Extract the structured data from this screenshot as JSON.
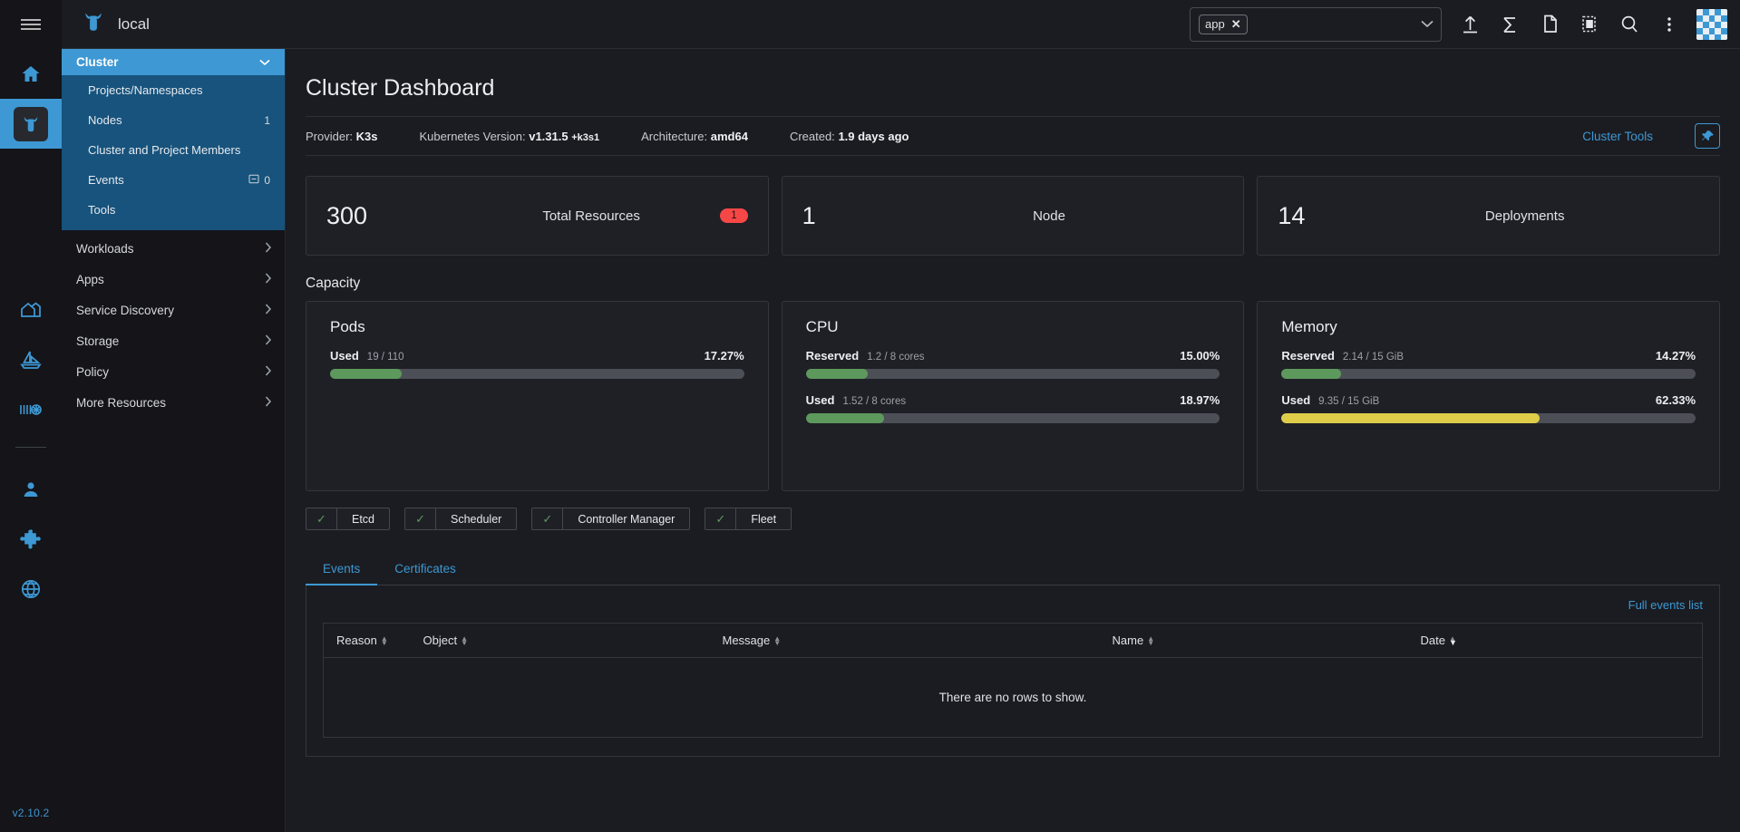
{
  "rail": {
    "hamburger": "menu-icon",
    "items": [
      {
        "icon": "home-icon",
        "name": "home",
        "active": false
      },
      {
        "icon": "cluster-icon",
        "name": "cluster-local",
        "active": true
      },
      {
        "icon": "barn-icon",
        "name": "cluster-management",
        "active": false
      },
      {
        "icon": "sailboat-icon",
        "name": "continuous-delivery",
        "active": false
      },
      {
        "icon": "containers-icon",
        "name": "virtualization",
        "active": false
      },
      {
        "icon": "user-icon",
        "name": "users-and-authentication",
        "active": false
      },
      {
        "icon": "puzzle-icon",
        "name": "extensions",
        "active": false
      },
      {
        "icon": "globe-icon",
        "name": "global-settings",
        "active": false
      }
    ],
    "version": "v2.10.2"
  },
  "topbar": {
    "brand_icon": "rancher-cow-icon",
    "title": "local",
    "namespace_filter": {
      "chip_label": "app",
      "chip_close": "✕",
      "caret": "chevron-down-icon"
    },
    "icons": [
      {
        "name": "import-yaml-icon",
        "glyph": "upload"
      },
      {
        "name": "kubectl-shell-icon",
        "glyph": "sigma"
      },
      {
        "name": "notes-icon",
        "glyph": "file"
      },
      {
        "name": "download-kubeconfig-icon",
        "glyph": "copy"
      },
      {
        "name": "search-icon",
        "glyph": "search"
      },
      {
        "name": "kebab-menu-icon",
        "glyph": "dots"
      }
    ],
    "avatar_name": "user-avatar"
  },
  "sidebar": {
    "group": {
      "label": "Cluster",
      "expanded": true,
      "caret": "chevron-down-icon",
      "children": [
        {
          "label": "Projects/Namespaces",
          "count": ""
        },
        {
          "label": "Nodes",
          "count": "1"
        },
        {
          "label": "Cluster and Project Members",
          "count": ""
        },
        {
          "label": "Events",
          "count": "0",
          "count_icon": "dash-square-icon"
        },
        {
          "label": "Tools",
          "count": ""
        }
      ]
    },
    "items": [
      {
        "label": "Workloads",
        "caret": "chevron-right-icon"
      },
      {
        "label": "Apps",
        "caret": "chevron-right-icon"
      },
      {
        "label": "Service Discovery",
        "caret": "chevron-right-icon"
      },
      {
        "label": "Storage",
        "caret": "chevron-right-icon"
      },
      {
        "label": "Policy",
        "caret": "chevron-right-icon"
      },
      {
        "label": "More Resources",
        "caret": "chevron-right-icon"
      }
    ]
  },
  "page": {
    "title": "Cluster Dashboard",
    "meta": [
      {
        "label": "Provider:",
        "value": "K3s",
        "sub": ""
      },
      {
        "label": "Kubernetes Version:",
        "value": "v1.31.5",
        "sub": "+k3s1"
      },
      {
        "label": "Architecture:",
        "value": "amd64",
        "sub": ""
      },
      {
        "label": "Created:",
        "value": "1.9 days ago",
        "sub": ""
      }
    ],
    "cluster_tools_label": "Cluster Tools",
    "pin_icon": "pin-icon"
  },
  "summary_cards": [
    {
      "value": "300",
      "label": "Total Resources",
      "badge": "1",
      "badge_color": "#f64747"
    },
    {
      "value": "1",
      "label": "Node",
      "badge": "",
      "badge_color": ""
    },
    {
      "value": "14",
      "label": "Deployments",
      "badge": "",
      "badge_color": ""
    }
  ],
  "capacity": {
    "section_label": "Capacity",
    "cards": [
      {
        "title": "Pods",
        "gauges": [
          {
            "name": "Used",
            "sub": "19 / 110",
            "pct_label": "17.27%",
            "pct": 17.27,
            "color": "#5d995d"
          }
        ]
      },
      {
        "title": "CPU",
        "gauges": [
          {
            "name": "Reserved",
            "sub": "1.2 / 8 cores",
            "pct_label": "15.00%",
            "pct": 15.0,
            "color": "#5d995d"
          },
          {
            "name": "Used",
            "sub": "1.52 / 8 cores",
            "pct_label": "18.97%",
            "pct": 18.97,
            "color": "#5d995d"
          }
        ]
      },
      {
        "title": "Memory",
        "gauges": [
          {
            "name": "Reserved",
            "sub": "2.14 / 15 GiB",
            "pct_label": "14.27%",
            "pct": 14.27,
            "color": "#5d995d"
          },
          {
            "name": "Used",
            "sub": "9.35 / 15 GiB",
            "pct_label": "62.33%",
            "pct": 62.33,
            "color": "#dfcd4a"
          }
        ]
      }
    ]
  },
  "component_status": [
    {
      "label": "Etcd",
      "state": "healthy",
      "tick": "✓"
    },
    {
      "label": "Scheduler",
      "state": "healthy",
      "tick": "✓"
    },
    {
      "label": "Controller Manager",
      "state": "healthy",
      "tick": "✓"
    },
    {
      "label": "Fleet",
      "state": "healthy",
      "tick": "✓"
    }
  ],
  "tabs": [
    {
      "label": "Events",
      "active": true
    },
    {
      "label": "Certificates",
      "active": false
    }
  ],
  "events_panel": {
    "full_events_label": "Full events list",
    "columns": [
      {
        "label": "Reason",
        "sorted": "none"
      },
      {
        "label": "Object",
        "sorted": "none"
      },
      {
        "label": "Message",
        "sorted": "none"
      },
      {
        "label": "Name",
        "sorted": "none"
      },
      {
        "label": "Date",
        "sorted": "desc"
      }
    ],
    "rows": [],
    "empty_text": "There are no rows to show."
  },
  "colors": {
    "accent": "#3d98d3",
    "bg": "#1b1c21",
    "panel": "#1f2025",
    "green": "#5d995d",
    "yellow": "#dfcd4a",
    "red": "#f64747"
  }
}
